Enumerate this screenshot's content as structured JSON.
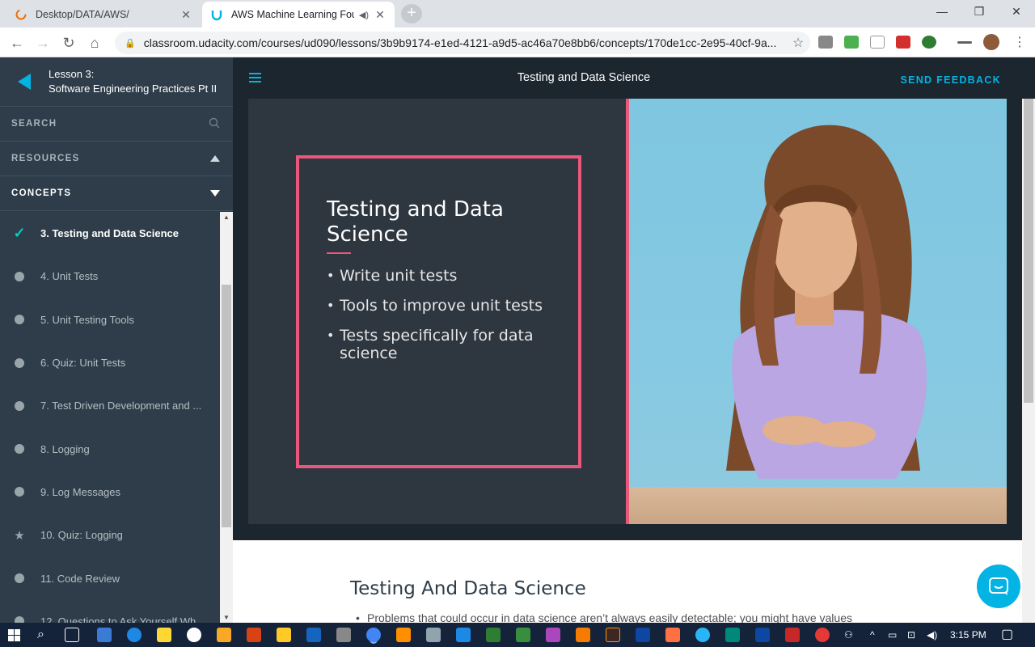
{
  "browser": {
    "tabs": [
      {
        "title": "Desktop/DATA/AWS/",
        "active": false
      },
      {
        "title": "AWS Machine Learning Foun",
        "active": true
      }
    ],
    "url": "classroom.udacity.com/courses/ud090/lessons/3b9b9174-e1ed-4121-a9d5-ac46a70e8bb6/concepts/170de1cc-2e95-40cf-9a..."
  },
  "sidebar": {
    "lesson_label": "Lesson 3:",
    "lesson_title": "Software Engineering Practices Pt II",
    "search_label": "SEARCH",
    "resources_label": "RESOURCES",
    "concepts_label": "CONCEPTS",
    "concepts": [
      {
        "label": "3. Testing and Data Science",
        "status": "complete"
      },
      {
        "label": "4. Unit Tests",
        "status": "video"
      },
      {
        "label": "5. Unit Testing Tools",
        "status": "video"
      },
      {
        "label": "6. Quiz: Unit Tests",
        "status": "video"
      },
      {
        "label": "7. Test Driven Development and ...",
        "status": "video"
      },
      {
        "label": "8. Logging",
        "status": "video"
      },
      {
        "label": "9. Log Messages",
        "status": "video"
      },
      {
        "label": "10. Quiz: Logging",
        "status": "quiz"
      },
      {
        "label": "11. Code Review",
        "status": "video"
      },
      {
        "label": "12. Questions to Ask Yourself Wh...",
        "status": "video"
      }
    ]
  },
  "header": {
    "title": "Testing and Data Science",
    "feedback_label": "SEND FEEDBACK"
  },
  "video": {
    "slide_title": "Testing and Data Science",
    "bullets": [
      "Write unit tests",
      "Tools to improve unit tests",
      "Tests specifically for data science"
    ]
  },
  "content": {
    "heading": "Testing And Data Science",
    "first_bullet": "Problems that could occur in data science aren’t always easily detectable; you might have values"
  },
  "taskbar": {
    "time": "3:15 PM"
  },
  "colors": {
    "accent": "#02b3e4",
    "sidebar_bg": "#2e3d49",
    "slide_border": "#e9577b",
    "check": "#02ccba"
  }
}
